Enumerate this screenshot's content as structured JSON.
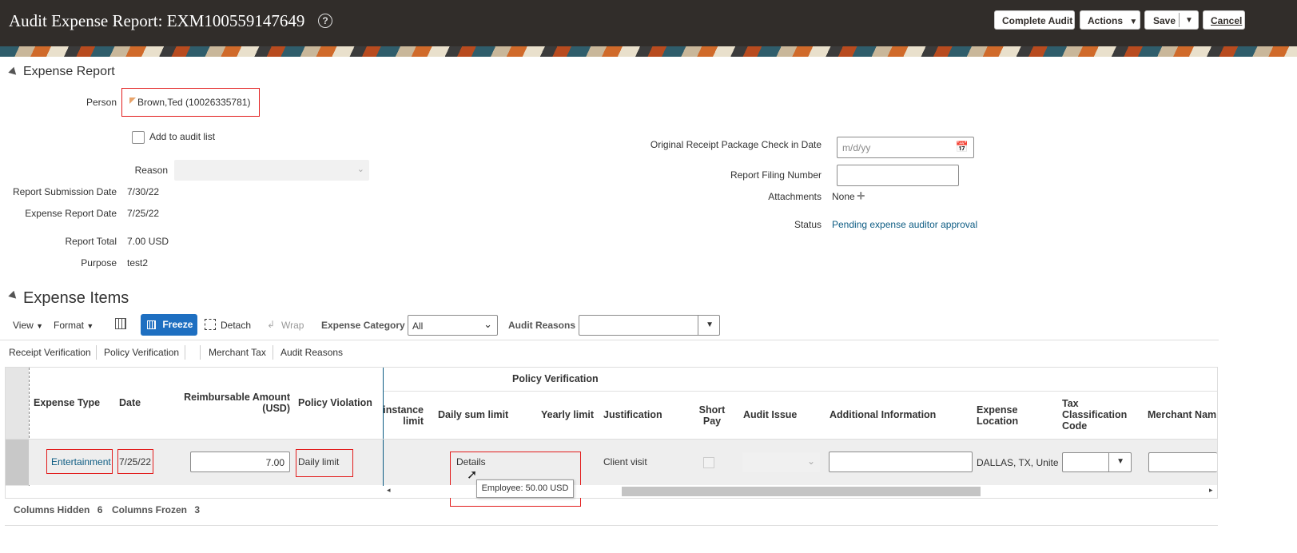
{
  "header": {
    "title": "Audit Expense Report: EXM100559147649",
    "complete_audit": "Complete Audit",
    "actions": "Actions",
    "save": "Save",
    "cancel": "Cancel"
  },
  "report": {
    "section_title": "Expense Report",
    "person_label": "Person",
    "person_value": "Brown,Ted (10026335781)",
    "add_audit_label": "Add to audit list",
    "reason_label": "Reason",
    "submission_label": "Report Submission Date",
    "submission_value": "7/30/22",
    "report_date_label": "Expense Report Date",
    "report_date_value": "7/25/22",
    "total_label": "Report Total",
    "total_value": "7.00 USD",
    "purpose_label": "Purpose",
    "purpose_value": "test2",
    "receipt_pkg_label": "Original Receipt Package Check in Date",
    "receipt_pkg_placeholder": "m/d/yy",
    "filing_label": "Report Filing Number",
    "attachments_label": "Attachments",
    "attachments_value": "None",
    "status_label": "Status",
    "status_value": "Pending expense auditor approval"
  },
  "items": {
    "section_title": "Expense Items",
    "toolbar": {
      "view": "View",
      "format": "Format",
      "freeze": "Freeze",
      "detach": "Detach",
      "wrap": "Wrap",
      "category_label": "Expense Category",
      "category_value": "All",
      "audit_reasons_label": "Audit Reasons"
    },
    "tabs": [
      "Receipt Verification",
      "Policy Verification",
      "Merchant Tax",
      "Audit Reasons"
    ],
    "group_header": "Policy Verification",
    "columns": {
      "expense_type": "Expense Type",
      "date": "Date",
      "reimbursable_1": "Reimbursable Amount",
      "reimbursable_2": "(USD)",
      "policy_violation": "Policy Violation",
      "instance_1": "instance",
      "instance_2": "limit",
      "daily_sum": "Daily sum limit",
      "yearly": "Yearly limit",
      "justification": "Justification",
      "short_1": "Short",
      "short_2": "Pay",
      "audit_issue": "Audit Issue",
      "additional": "Additional Information",
      "location_1": "Expense",
      "location_2": "Location",
      "tax_1": "Tax",
      "tax_2": "Classification",
      "tax_3": "Code",
      "merchant": "Merchant Nam"
    },
    "row": {
      "expense_type": "Entertainment",
      "date": "7/25/22",
      "amount": "7.00",
      "policy_violation": "Daily limit",
      "daily_sum": "Details",
      "justification": "Client visit",
      "location": "DALLAS, TX, Unite"
    },
    "tooltip": "Employee: 50.00 USD",
    "footer": {
      "hidden_label": "Columns Hidden",
      "hidden_value": "6",
      "frozen_label": "Columns Frozen",
      "frozen_value": "3"
    }
  }
}
